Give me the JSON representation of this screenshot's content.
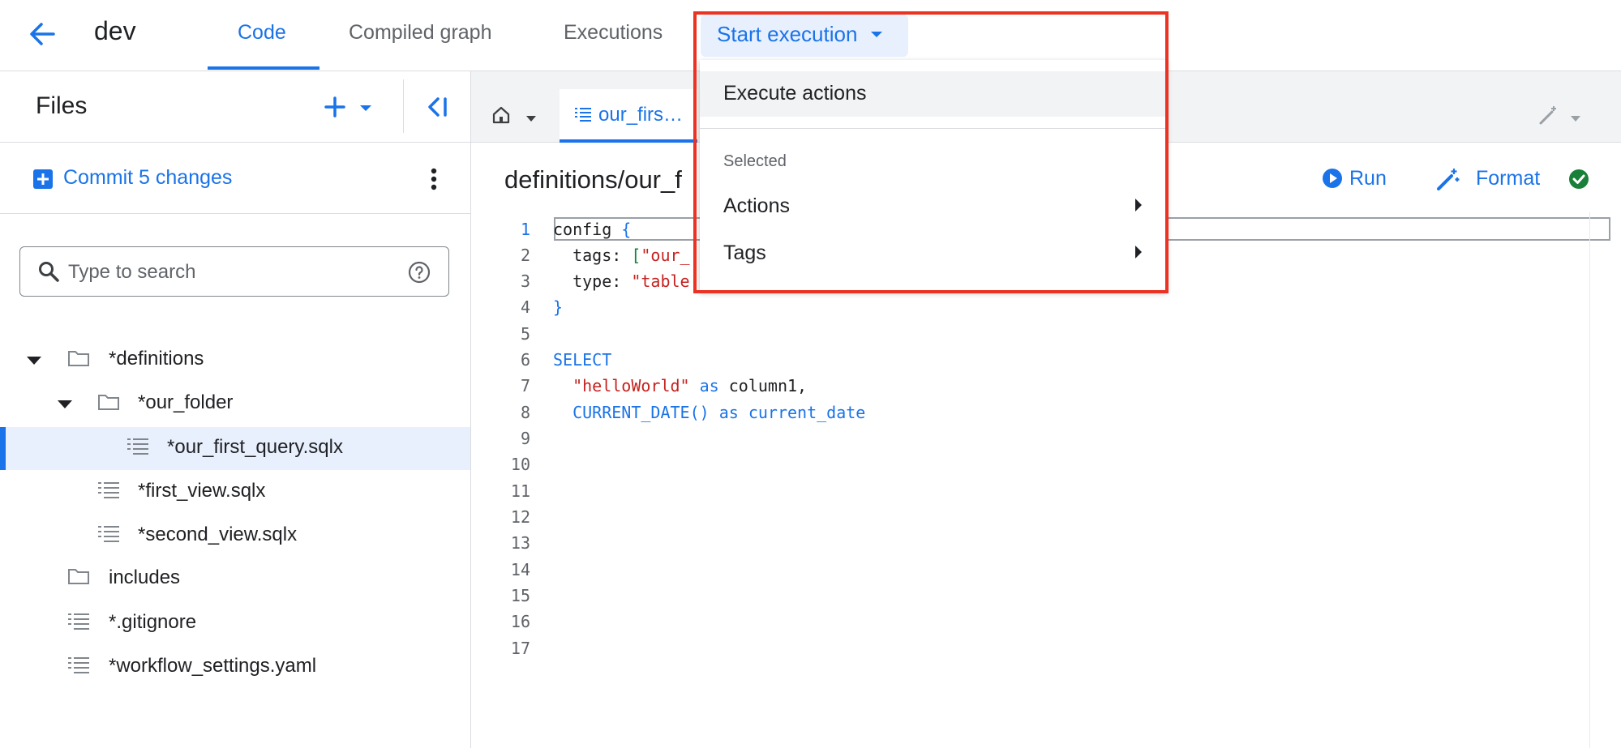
{
  "header": {
    "back_icon": "arrow-back-icon",
    "title": "dev",
    "tabs": [
      {
        "label": "Code",
        "active": true
      },
      {
        "label": "Compiled graph",
        "active": false
      },
      {
        "label": "Executions",
        "active": false
      }
    ],
    "start_execution_label": "Start execution"
  },
  "sidebar": {
    "title": "Files",
    "commit_label": "Commit 5 changes",
    "search_placeholder": "Type to search",
    "tree": [
      {
        "label": "*definitions",
        "type": "folder",
        "expanded": true
      },
      {
        "label": "*our_folder",
        "type": "folder",
        "expanded": true
      },
      {
        "label": "*our_first_query.sqlx",
        "type": "file",
        "selected": true
      },
      {
        "label": "*first_view.sqlx",
        "type": "file"
      },
      {
        "label": "*second_view.sqlx",
        "type": "file"
      },
      {
        "label": "includes",
        "type": "folder"
      },
      {
        "label": "*.gitignore",
        "type": "file"
      },
      {
        "label": "*workflow_settings.yaml",
        "type": "file"
      }
    ]
  },
  "editor": {
    "tab_label": "our_firs… ",
    "path": "definitions/our_f",
    "run_label": "Run",
    "format_label": "Format",
    "line_numbers": [
      "1",
      "2",
      "3",
      "4",
      "5",
      "6",
      "7",
      "8",
      "9",
      "10",
      "11",
      "12",
      "13",
      "14",
      "15",
      "16",
      "17"
    ],
    "code": {
      "l1a": "config ",
      "l1b": "{",
      "l2a": "  tags: ",
      "l2b": "[",
      "l2c": "\"our_",
      "l3a": "  type: ",
      "l3b": "\"table",
      "l4": "}",
      "l6": "SELECT",
      "l7a": "  ",
      "l7b": "\"helloWorld\"",
      "l7c": " as ",
      "l7d": "column1,",
      "l8a": "  CURRENT_DATE() as current_date"
    }
  },
  "menu": {
    "execute_actions": "Execute actions",
    "section_label": "Selected",
    "actions": "Actions",
    "tags": "Tags"
  },
  "colors": {
    "accent": "#1a73e8",
    "highlight_border": "#ea3323",
    "success": "#188038"
  }
}
